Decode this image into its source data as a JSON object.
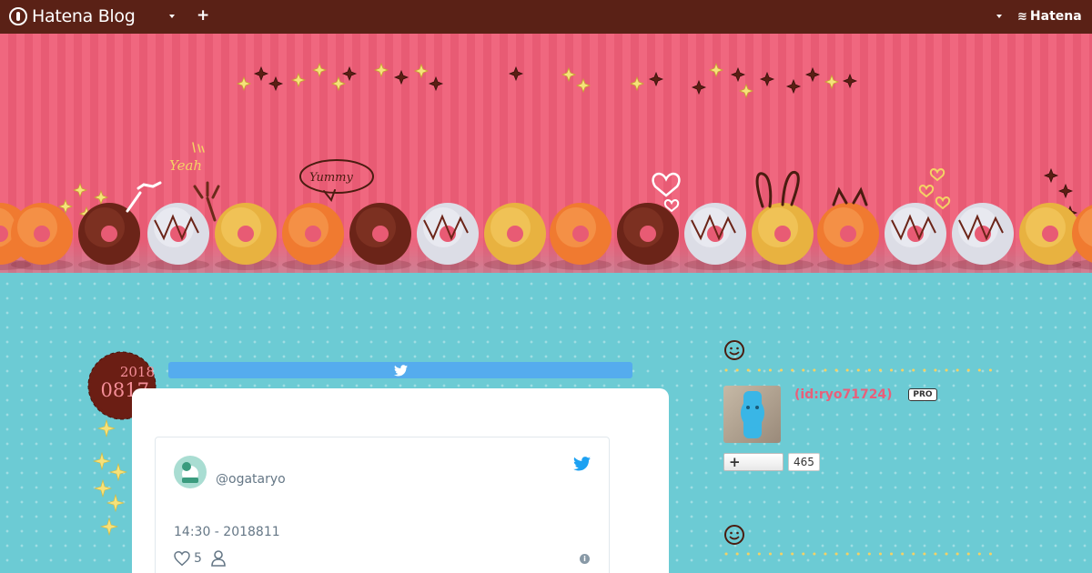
{
  "topbar": {
    "brand": "Hatena Blog",
    "add_icon": "plus-icon",
    "menu_icon": "caret-down-icon",
    "hatena_label": "Hatena",
    "background": "#5a2116"
  },
  "header": {
    "banner_description": "",
    "colors": {
      "pink": "#f0677f",
      "teal": "#6ccbd4"
    }
  },
  "entry": {
    "date_year": "2018",
    "date_md": "0817",
    "share_icon": "twitter-icon",
    "tweet": {
      "username": "@ogataryo",
      "time": "14:30 - 2018811",
      "likes": "5",
      "bird_icon": "twitter-bird-icon",
      "heart_icon": "heart-icon",
      "person_icon": "person-icon",
      "info_icon": "info-icon",
      "info_glyph": "i"
    }
  },
  "sidebar": {
    "profile": {
      "id": "(id:ryo71724)",
      "badge": "PRO",
      "follow_symbol": "+",
      "follower_count": "465"
    },
    "smiley_icon": "smiley-icon"
  }
}
